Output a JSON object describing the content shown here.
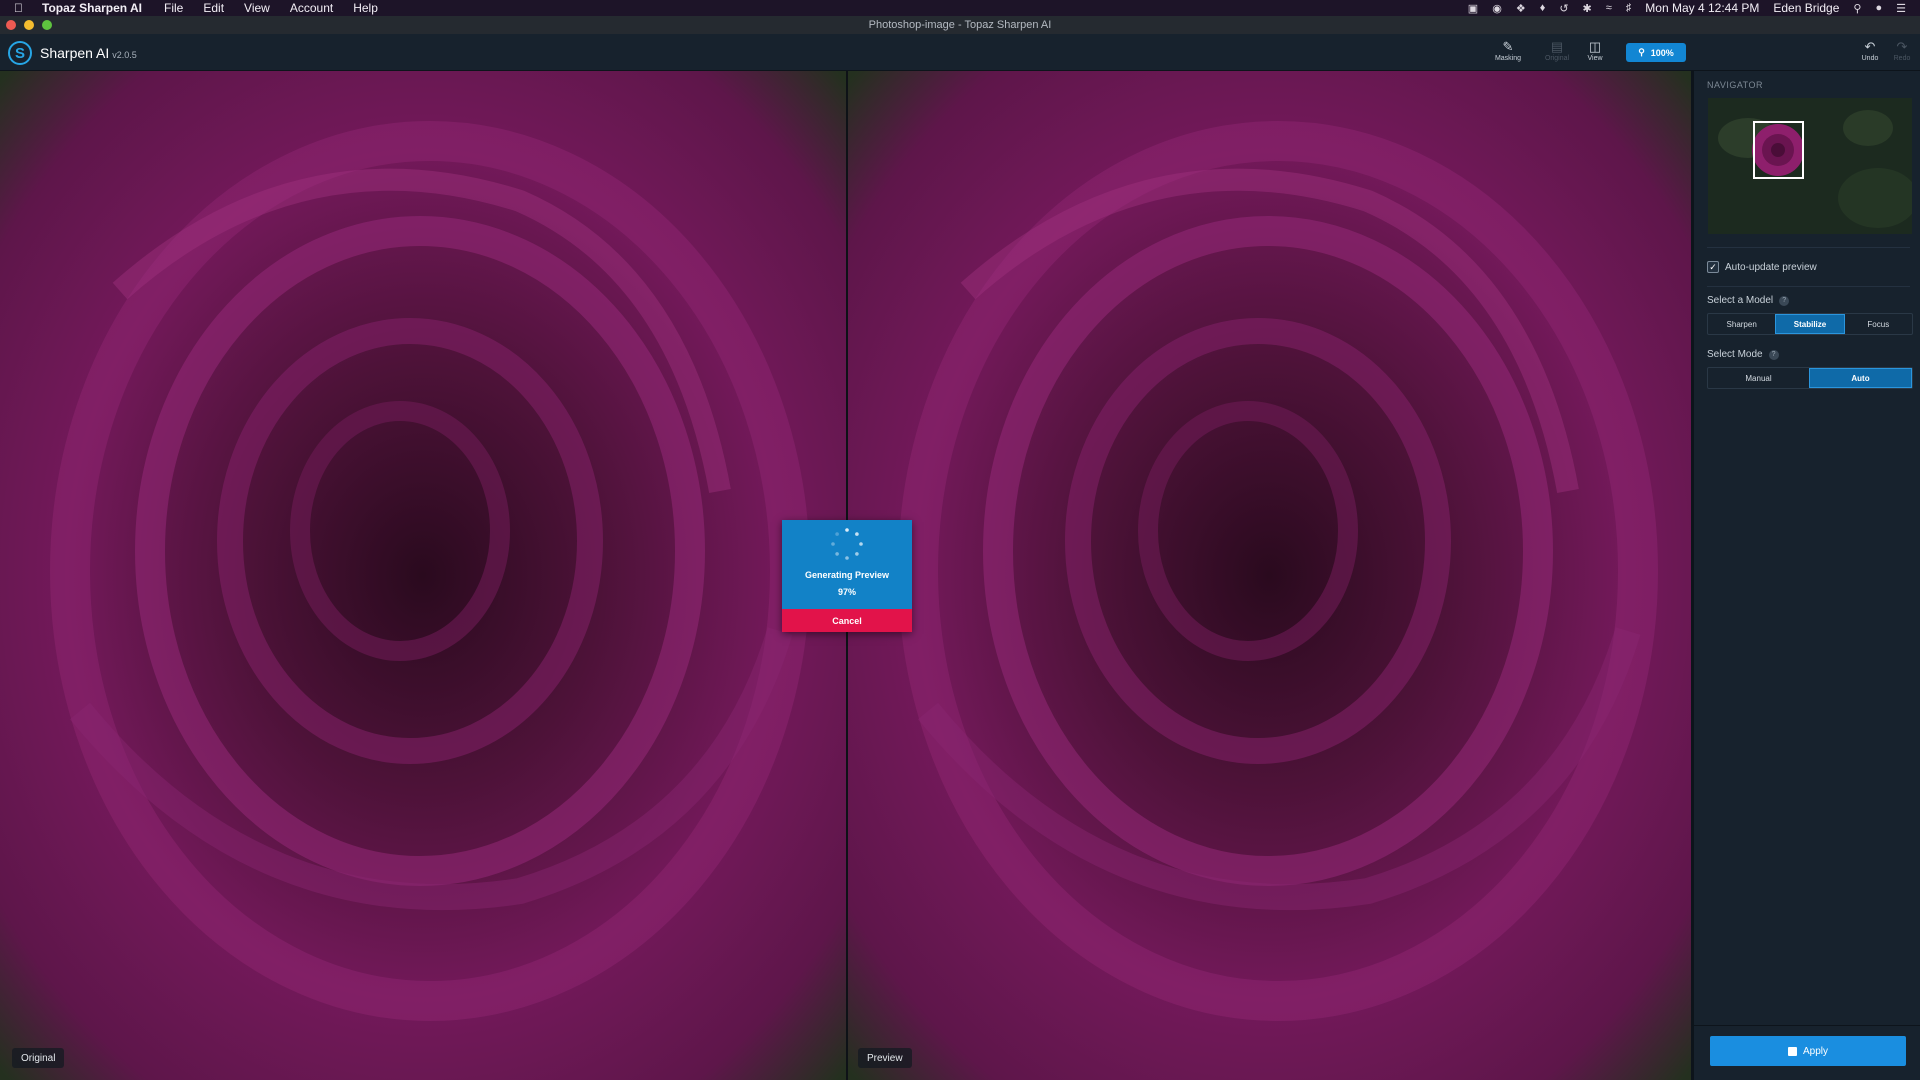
{
  "menubar": {
    "app_name": "Topaz Sharpen AI",
    "menus": [
      "File",
      "Edit",
      "View",
      "Account",
      "Help"
    ],
    "clock": "Mon May 4  12:44 PM",
    "user": "Eden Bridge"
  },
  "window": {
    "title": "Photoshop-image - Topaz Sharpen AI"
  },
  "toolbar": {
    "app_title": "Sharpen AI",
    "version": "v2.0.5",
    "masking_label": "Masking",
    "original_label": "Original",
    "view_label": "View",
    "zoom_label": "100%",
    "undo_label": "Undo",
    "redo_label": "Redo"
  },
  "canvas": {
    "left_label": "Original",
    "right_label": "Preview"
  },
  "dialog": {
    "message": "Generating Preview",
    "percent_text": "97%",
    "progress": 0.97,
    "cancel_label": "Cancel"
  },
  "sidebar": {
    "navigator_title": "NAVIGATOR",
    "auto_update_label": "Auto-update preview",
    "auto_update_checked": true,
    "model_label": "Select a Model",
    "models": [
      "Sharpen",
      "Stabilize",
      "Focus"
    ],
    "selected_model": "Stabilize",
    "mode_label": "Select Mode",
    "modes": [
      "Manual",
      "Auto"
    ],
    "selected_mode": "Auto",
    "apply_label": "Apply"
  },
  "colors": {
    "accent": "#1a8ee0",
    "cancel": "#e2134a",
    "rose": "#7a1a5a"
  }
}
